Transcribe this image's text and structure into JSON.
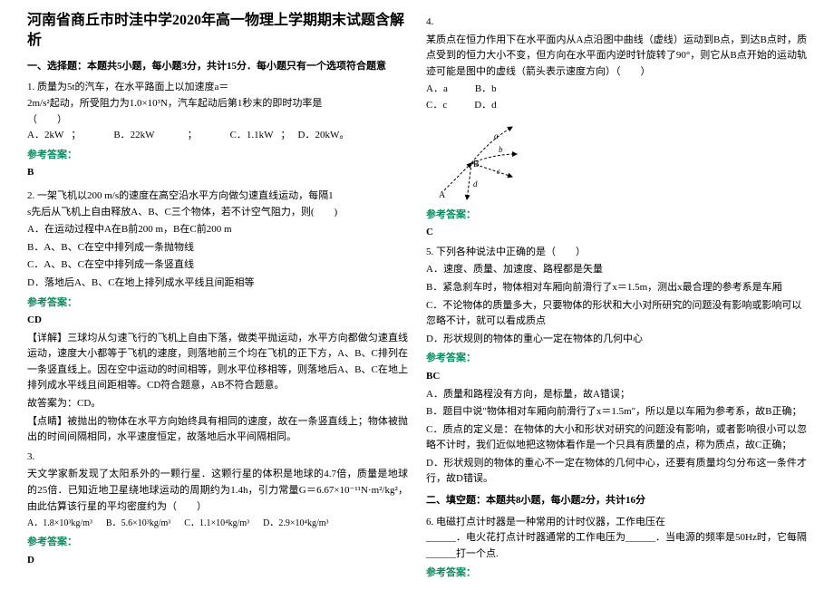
{
  "title": "河南省商丘市时洼中学2020年高一物理上学期期末试题含解析",
  "section1": {
    "header": "一、选择题：本题共5小题，每小题3分，共计15分．每小题只有一个选项符合题意",
    "q1": {
      "text": "1. 质量为5t的汽车，在水平路面上以加速度a＝",
      "line2": "2m/s²起动，所受阻力为1.0×10³N，汽车起动后第1秒末的即时功率是",
      "bracket": "（　　）",
      "optA": "A．2kW",
      "optB": "B．22kW",
      "col": "；",
      "optC": "C．1.1kW",
      "sep": "；",
      "optD": "D．20kW。",
      "answer": "B"
    },
    "q2": {
      "text": "2. 一架飞机以200 m/s的速度在高空沿水平方向做匀速直线运动，每隔1",
      "line2": "s先后从飞机上自由释放A、B、C三个物体，若不计空气阻力，则(　　)",
      "optA": "A．在运动过程中A在B前200 m，B在C前200 m",
      "optB": "B．A、B、C在空中排列成一条抛物线",
      "optC": "C．A、B、C在空中排列成一条竖直线",
      "optD": "D．落地后A、B、C在地上排列成水平线且间距相等",
      "answer": "CD",
      "exp1": "【详解】三球均从匀速飞行的飞机上自由下落，做类平抛运动，水平方向都做匀速直线运动，速度大小都等于飞机的速度，则落地前三个均在飞机的正下方，A、B、C排列在一条竖直线上。因在空中运动的时间相等，则水平位移相等，则落地后A、B、C在地上排列成水平线且间距相等。CD符合题意，AB不符合题意。",
      "exp2": "故答案为：CD。",
      "exp3": "【点睛】被抛出的物体在水平方向始终具有相同的速度，故在一条竖直线上；物体被抛出的时间间隔相同，水平速度恒定，故落地后水平间隔相同。"
    },
    "q3": {
      "num": "3.",
      "text": "天文学家新发现了太阳系外的一颗行星．这颗行星的体积是地球的4.7倍，质量是地球的25倍．已知近地卫星绕地球运动的周期约为1.4h，引力常量G＝6.67×10⁻¹¹N·m²/kg²，由此估算该行星的平均密度约为（　　）",
      "optA": "A．1.8×10³kg/m³",
      "optB": "B．5.6×10³kg/m³",
      "optC": "C．1.1×10⁴kg/m³",
      "optD": "D．2.9×10⁴kg/m³",
      "answer": "D"
    }
  },
  "section2": {
    "q4": {
      "num": "4.",
      "text": "某质点在恒力作用下在水平面内从A点沿图中曲线（虚线）运动到B点，到达B点时，质点受到的恒力大小不变，但方向在水平面内逆时针旋转了90°，则它从B点开始的运动轨迹可能是图中的虚线（箭头表示速度方向）（　　）",
      "optA": "A．a",
      "optB": "B．b",
      "optC": "C．c",
      "optD": "D．d",
      "answer": "C"
    },
    "q5": {
      "text": "5. 下列各种说法中正确的是（　　）",
      "optA": "A．速度、质量、加速度、路程都是矢量",
      "optB": "B．紧急刹车时，物体相对车厢向前滑行了x＝1.5m，测出x最合理的参考系是车厢",
      "optC": "C．不论物体的质量多大，只要物体的形状和大小对所研究的问题没有影响或影响可以忽略不计，就可以看成质点",
      "optD": "D．形状规则的物体的重心一定在物体的几何中心",
      "answer": "BC",
      "expA": "A．质量和路程没有方向，是标量，故A错误；",
      "expB": "B．题目中说\"物体相对车厢向前滑行了x＝1.5m\"，所以是以车厢为参考系，故B正确；",
      "expC": "C．质点的定义是：在物体的大小和形状对研究的问题没有影响，或者影响很小可以忽略不计时，我们近似地把这物体看作是一个只具有质量的点，称为质点，故C正确；",
      "expD": "D．形状规则的物体的重心不一定在物体的几何中心，还要有质量均匀分布这一条件才行，故D错误。"
    },
    "section2_header": "二、填空题：本题共8小题，每小题2分，共计16分",
    "q6": {
      "text": "6. 电磁打点计时器是一种常用的计时仪器，工作电压在",
      "text2": "______．电火花打点计时器通常的工作电压为______．当电源的频率是50Hz时，它每隔______打一个点."
    }
  },
  "labels": {
    "answer": "参考答案：",
    "diagram": {
      "A": "A",
      "B": "B",
      "a": "a",
      "b": "b",
      "c": "c",
      "d": "d"
    }
  }
}
